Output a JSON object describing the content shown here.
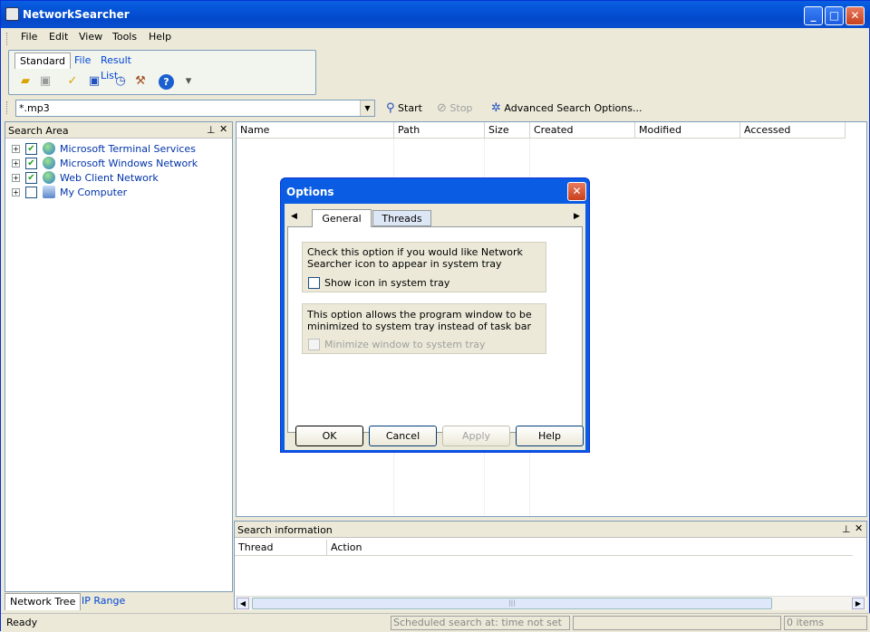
{
  "app": {
    "title": "NetworkSearcher"
  },
  "menu": [
    "File",
    "Edit",
    "View",
    "Tools",
    "Help"
  ],
  "toolbar_tabs": [
    "Standard",
    "File",
    "Result List"
  ],
  "toolbar_icons": [
    "open-folder-icon",
    "save-icon",
    "check-folder-icon",
    "check-save-icon",
    "schedule-icon",
    "tools-icon",
    "help-icon",
    "info-icon"
  ],
  "search": {
    "value": "*.mp3",
    "start_label": "Start",
    "stop_label": "Stop",
    "advanced_label": "Advanced Search Options..."
  },
  "search_area": {
    "title": "Search Area",
    "items": [
      {
        "label": "Microsoft Terminal Services",
        "checked": true
      },
      {
        "label": "Microsoft Windows Network",
        "checked": true
      },
      {
        "label": "Web Client Network",
        "checked": true
      },
      {
        "label": "My Computer",
        "checked": false
      }
    ],
    "tabs": [
      "Network Tree",
      "IP Range"
    ]
  },
  "results": {
    "columns": [
      "Name",
      "Path",
      "Size",
      "Created",
      "Modified",
      "Accessed"
    ]
  },
  "search_info": {
    "title": "Search information",
    "columns": [
      "Thread",
      "Action"
    ]
  },
  "status": {
    "ready": "Ready",
    "scheduled": "Scheduled search at:  time not set",
    "items": "0 items"
  },
  "dialog": {
    "title": "Options",
    "tabs": [
      "General",
      "Threads"
    ],
    "group1_text": "Check this option if you would like Network Searcher icon to appear in system tray",
    "group1_checkbox": "Show icon in system tray",
    "group2_text": "This option allows the program window to be minimized to system tray instead of task bar",
    "group2_checkbox": "Minimize window to system tray",
    "buttons": {
      "ok": "OK",
      "cancel": "Cancel",
      "apply": "Apply",
      "help": "Help"
    }
  }
}
